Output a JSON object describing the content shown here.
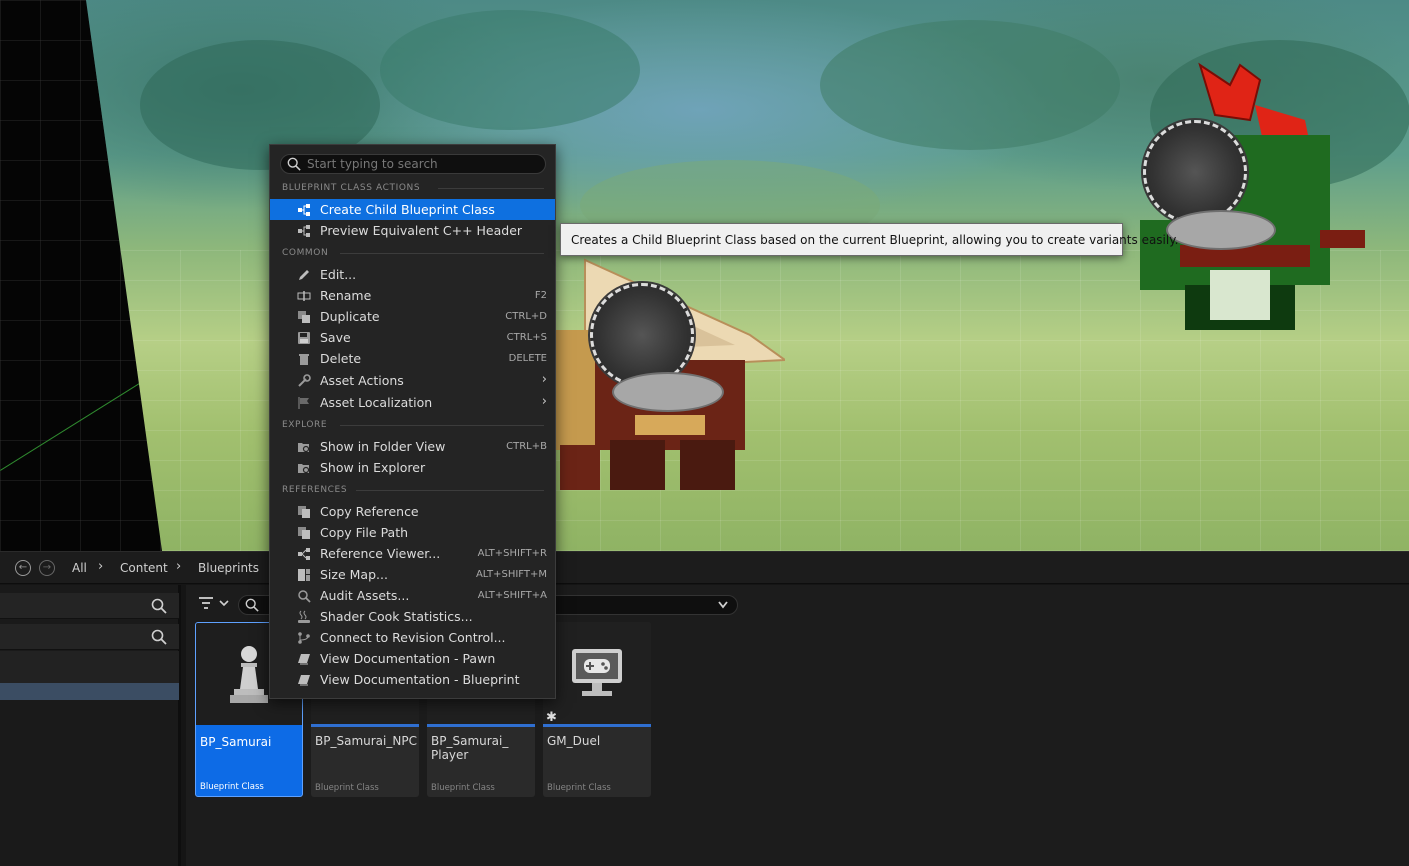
{
  "context_menu": {
    "search_placeholder": "Start typing to search",
    "sections": {
      "blueprint_class_actions": "BLUEPRINT CLASS ACTIONS",
      "common": "COMMON",
      "explore": "EXPLORE",
      "references": "REFERENCES"
    },
    "items": [
      {
        "label": "Create Child Blueprint Class",
        "shortcut": "",
        "icon": "child-class-icon"
      },
      {
        "label": "Preview Equivalent C++ Header",
        "shortcut": "",
        "icon": "header-preview-icon"
      },
      {
        "label": "Edit...",
        "shortcut": "",
        "icon": "pencil-icon"
      },
      {
        "label": "Rename",
        "shortcut": "F2",
        "icon": "rename-icon"
      },
      {
        "label": "Duplicate",
        "shortcut": "CTRL+D",
        "icon": "duplicate-icon"
      },
      {
        "label": "Save",
        "shortcut": "CTRL+S",
        "icon": "save-icon"
      },
      {
        "label": "Delete",
        "shortcut": "DELETE",
        "icon": "trash-icon"
      },
      {
        "label": "Asset Actions",
        "shortcut": "",
        "icon": "wrench-icon"
      },
      {
        "label": "Asset Localization",
        "shortcut": "",
        "icon": "flag-icon"
      },
      {
        "label": "Show in Folder View",
        "shortcut": "CTRL+B",
        "icon": "folder-search-icon"
      },
      {
        "label": "Show in Explorer",
        "shortcut": "",
        "icon": "folder-search-icon"
      },
      {
        "label": "Copy Reference",
        "shortcut": "",
        "icon": "copy-icon"
      },
      {
        "label": "Copy File Path",
        "shortcut": "",
        "icon": "copy-icon"
      },
      {
        "label": "Reference Viewer...",
        "shortcut": "ALT+SHIFT+R",
        "icon": "reference-viewer-icon"
      },
      {
        "label": "Size Map...",
        "shortcut": "ALT+SHIFT+M",
        "icon": "size-map-icon"
      },
      {
        "label": "Audit Assets...",
        "shortcut": "ALT+SHIFT+A",
        "icon": "audit-icon"
      },
      {
        "label": "Shader Cook Statistics...",
        "shortcut": "",
        "icon": "shader-cook-icon"
      },
      {
        "label": "Connect to Revision Control...",
        "shortcut": "",
        "icon": "branch-icon"
      },
      {
        "label": "View Documentation - Pawn",
        "shortcut": "",
        "icon": "book-icon"
      },
      {
        "label": "View Documentation - Blueprint",
        "shortcut": "",
        "icon": "book-icon"
      }
    ]
  },
  "tooltip": {
    "text": "Creates a Child Blueprint Class based on the current Blueprint, allowing you to create variants easily."
  },
  "breadcrumb": [
    "All",
    "Content",
    "Blueprints"
  ],
  "assets": [
    {
      "name": "BP_Samurai",
      "type": "Blueprint Class",
      "selected": true,
      "icon": "pawn-icon"
    },
    {
      "name": "BP_Samurai_NPC",
      "type": "Blueprint Class",
      "selected": false,
      "icon": ""
    },
    {
      "name": "BP_Samurai_\nPlayer",
      "type": "Blueprint Class",
      "selected": false,
      "icon": ""
    },
    {
      "name": "GM_Duel",
      "type": "Blueprint Class",
      "selected": false,
      "icon": "game-mode-icon"
    }
  ],
  "colors": {
    "highlight": "#0e70e0",
    "menu_bg": "#242424",
    "selected_tile": "#0d6be6"
  }
}
